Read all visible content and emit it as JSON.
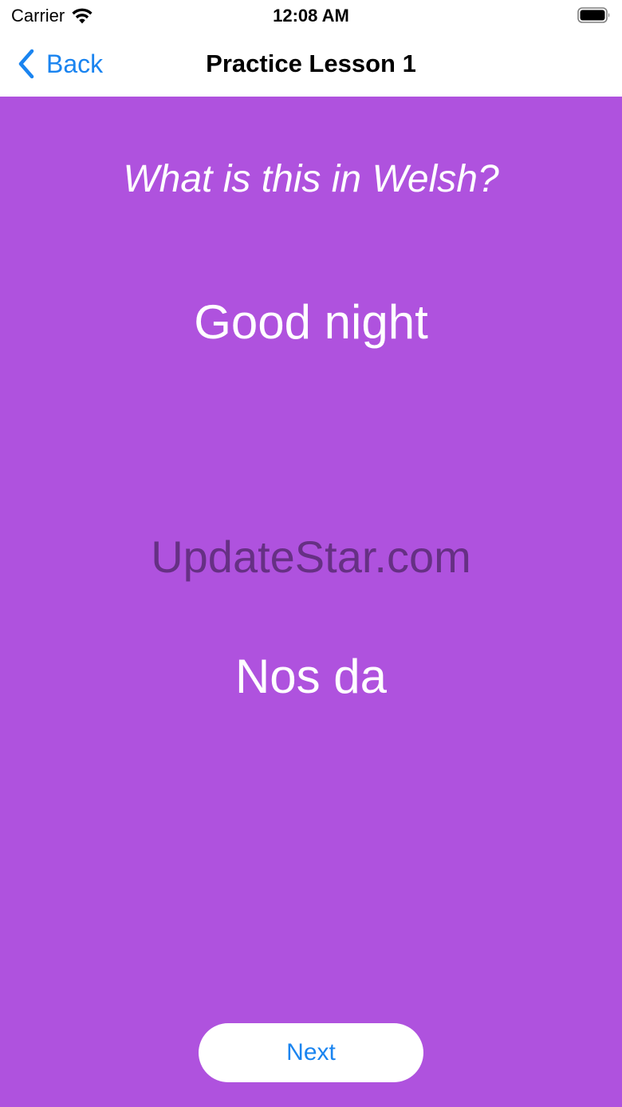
{
  "status_bar": {
    "carrier": "Carrier",
    "time": "12:08 AM",
    "icons": [
      "wifi-icon",
      "battery-icon"
    ]
  },
  "nav_bar": {
    "back_label": "Back",
    "title": "Practice Lesson 1",
    "back_icon": "chevron-left-icon"
  },
  "lesson": {
    "question": "What is this in Welsh?",
    "prompt": "Good night",
    "answer": "Nos da",
    "next_label": "Next"
  },
  "watermark": "UpdateStar.com",
  "colors": {
    "background": "#af52de",
    "accent": "#1a84f0",
    "text_light": "#ffffff",
    "watermark": "#5a2b75"
  }
}
